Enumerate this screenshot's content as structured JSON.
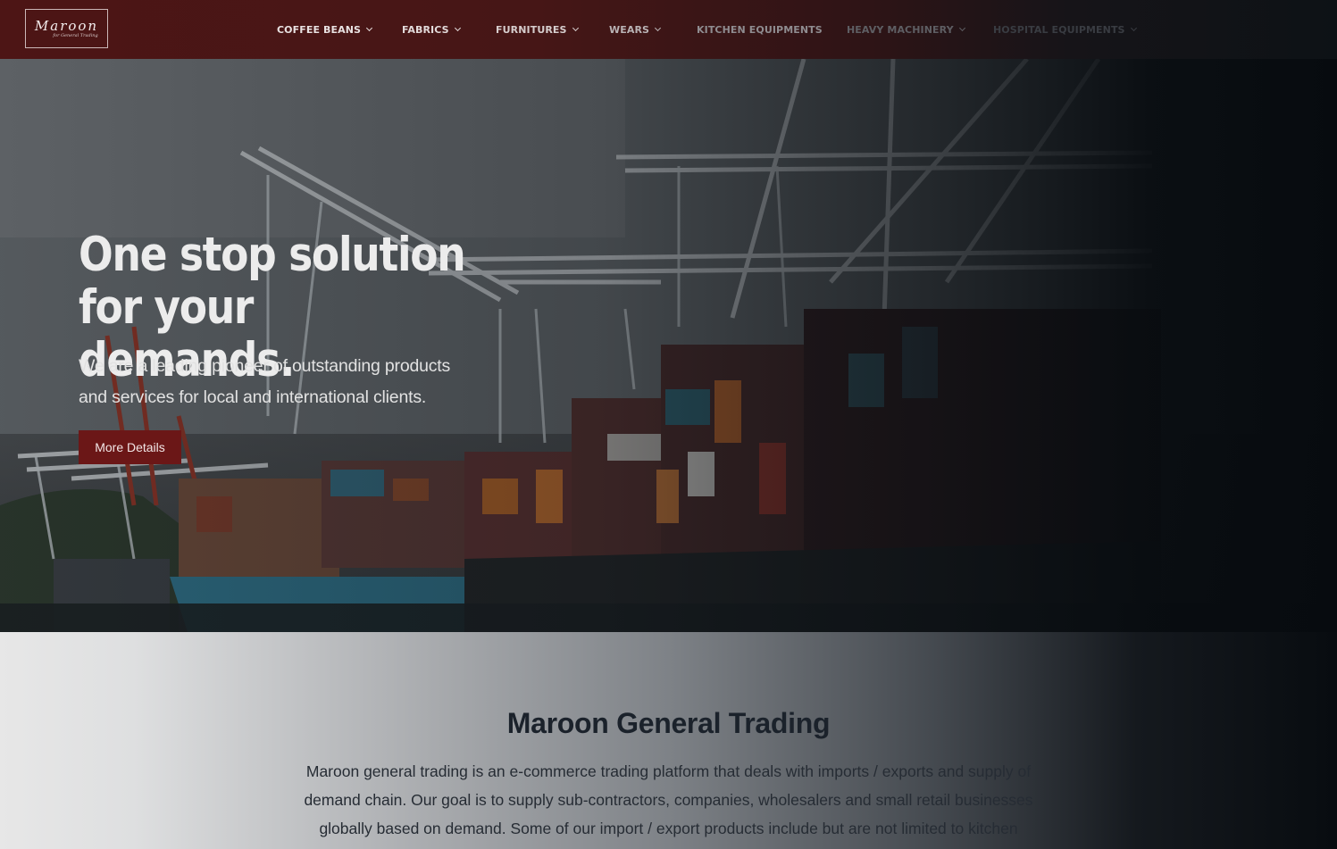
{
  "brand": {
    "logo_script": "Maroon",
    "logo_sub": "for General Trading"
  },
  "nav": {
    "items": [
      {
        "label": "COFFEE BEANS",
        "dropdown": true
      },
      {
        "label": "FABRICS",
        "dropdown": true
      },
      {
        "label": "FURNITURES",
        "dropdown": true
      },
      {
        "label": "WEARS",
        "dropdown": true
      },
      {
        "label": "KITCHEN EQUIPMENTS",
        "dropdown": false
      },
      {
        "label": "HEAVY MACHINERY",
        "dropdown": true
      },
      {
        "label": "HOSPITAL EQUIPMENTS",
        "dropdown": true
      }
    ]
  },
  "hero": {
    "title_line1": "One stop solution",
    "title_line2": "for your demands.",
    "subtitle_line1": "We are a leading pioneer of outstanding products",
    "subtitle_line2": "and services for local and international clients.",
    "button_label": "More Details"
  },
  "about": {
    "title": "Maroon General Trading",
    "text": "Maroon general trading is an e-commerce trading platform that deals with imports / exports and supply of demand chain. Our goal is to supply sub-contractors, companies, wholesalers and small retail businesses globally based on demand. Some of our import / export products include but are not limited to kitchen"
  },
  "colors": {
    "brand_maroon": "#4d1515",
    "button": "#6b1717",
    "heading": "#1b222b"
  }
}
